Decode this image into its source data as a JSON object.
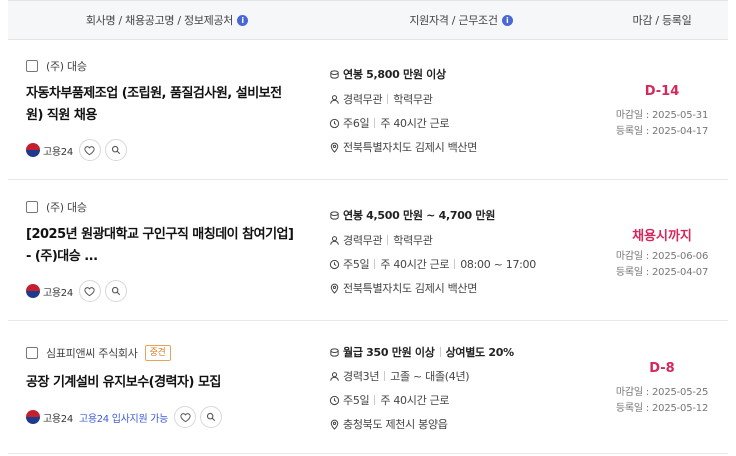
{
  "header": {
    "col1": "회사명 / 채용공고명 / 정보제공처",
    "col2": "지원자격 / 근무조건",
    "col3": "마감 / 등록일",
    "info": "i"
  },
  "jobs": [
    {
      "company": "(주) 대승",
      "title_line1": "자동차부품제조업 (조립원, 품질검사원, 설비보전",
      "title_line2": "원) 직원 채용",
      "source": "고용24",
      "salary": "연봉 5,800 만원 이상",
      "career": "경력무관",
      "education": "학력무관",
      "days": "주6일",
      "hours": "주 40시간 근로",
      "location": "전북특별자치도 김제시 백산면",
      "dday": "D-14",
      "deadline": "마감일 : 2025-05-31",
      "registered": "등록일 : 2025-04-17"
    },
    {
      "company": "(주) 대승",
      "title_line1": "[2025년 원광대학교 구인구직 매칭데이 참여기업]",
      "title_line2": "- (주)대승 ...",
      "source": "고용24",
      "salary": "연봉 4,500 만원 ~ 4,700 만원",
      "career": "경력무관",
      "education": "학력무관",
      "days": "주5일",
      "hours": "주 40시간 근로",
      "time": "08:00 ~ 17:00",
      "location": "전북특별자치도 김제시 백산면",
      "dday": "채용시까지",
      "deadline": "마감일 : 2025-06-06",
      "registered": "등록일 : 2025-04-07"
    },
    {
      "company": "심표피앤씨 주식회사",
      "tag": "중견",
      "title_line1": "공장 기계설비 유지보수(경력자) 모집",
      "source": "고용24",
      "support": "고용24 입사지원 가능",
      "salary": "월급 350 만원 이상",
      "bonus": "상여별도 20%",
      "career": "경력3년",
      "education": "고졸 ~ 대졸(4년)",
      "days": "주5일",
      "hours": "주 40시간 근로",
      "location": "충청북도 제천시 봉양읍",
      "dday": "D-8",
      "deadline": "마감일 : 2025-05-25",
      "registered": "등록일 : 2025-05-12"
    }
  ],
  "icons": {
    "salary": "coin-icon",
    "person": "person-icon",
    "clock": "clock-icon",
    "location": "location-pin-icon",
    "heart": "heart-icon",
    "search": "search-icon"
  },
  "colors": {
    "accent": "#d6275a",
    "info": "#4a67d6",
    "link": "#3b5bd6",
    "tag": "#d9822b"
  }
}
